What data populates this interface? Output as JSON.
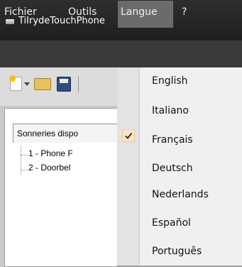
{
  "window": {
    "title": "TiIrydeTouchPhone"
  },
  "menubar": {
    "items": [
      "Fichier",
      "Outils",
      "Langue",
      "?"
    ],
    "active": "Langue"
  },
  "toolbar": {
    "buttons": [
      "new-icon",
      "open-icon",
      "save-icon"
    ]
  },
  "panel": {
    "tab_label": "Sonneries dispo",
    "tree_items": [
      "1 - Phone F",
      "2 - Doorbel"
    ]
  },
  "language_menu": {
    "items": [
      "English",
      "Italiano",
      "Français",
      "Deutsch",
      "Nederlands",
      "Español",
      "Português"
    ],
    "checked": "Français"
  }
}
